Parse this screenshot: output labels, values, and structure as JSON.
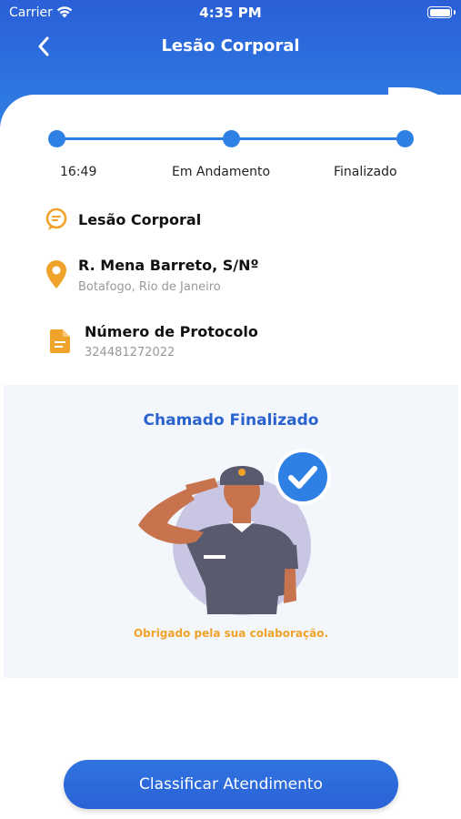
{
  "status_bar": {
    "carrier": "Carrier",
    "time": "4:35 PM"
  },
  "header": {
    "title": "Lesão Corporal",
    "back_icon": "chevron-left-icon"
  },
  "progress": {
    "steps": [
      {
        "label": "16:49"
      },
      {
        "label": "Em Andamento"
      },
      {
        "label": "Finalizado"
      }
    ]
  },
  "details": {
    "occurrence_type": "Lesão Corporal",
    "address": {
      "street": "R. Mena Barreto, S/Nº",
      "city": "Botafogo, Rio de Janeiro"
    },
    "protocol": {
      "label": "Número de Protocolo",
      "number": "324481272022"
    }
  },
  "finish_card": {
    "title": "Chamado Finalizado",
    "message": "Obrigado pela sua colaboração."
  },
  "actions": {
    "rate_label": "Classificar Atendimento"
  },
  "colors": {
    "primary": "#2f80e4",
    "accent": "#f0a32a",
    "card_bg": "#f3f6fa"
  }
}
